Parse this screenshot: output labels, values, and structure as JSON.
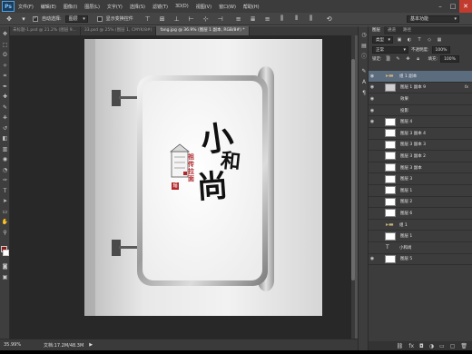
{
  "app": {
    "logo": "Ps"
  },
  "menu": [
    "文件(F)",
    "编辑(E)",
    "图像(I)",
    "图层(L)",
    "文字(Y)",
    "选择(S)",
    "滤镜(T)",
    "3D(D)",
    "视图(V)",
    "窗口(W)",
    "帮助(H)"
  ],
  "window_controls": {
    "minimize": "–",
    "maximize": "□",
    "close": "✕"
  },
  "options": {
    "auto_select_label": "自动选择:",
    "auto_select_checked": true,
    "auto_select_value": "图层",
    "transform_label": "显示变换控件",
    "workspace": "基本功能"
  },
  "tabs": [
    {
      "label": "未标题-1.psd @ 21.2% (图层 9...",
      "active": false
    },
    {
      "label": "33.psd @ 25% (图层 1, CMYK/8#)",
      "active": false
    },
    {
      "label": "fang.jpg @ 36.9% (图层 1 副本, RGB/8#) *",
      "active": true
    }
  ],
  "status": {
    "zoom": "35.99%",
    "doc_info": "文档:17.2M/48.3M",
    "arrow": "▶"
  },
  "layers_panel": {
    "tabs": [
      "图层",
      "通道",
      "路径"
    ],
    "filter_kind": "类型",
    "blend_mode": "正常",
    "opacity_label": "不透明度:",
    "opacity_value": "100%",
    "lock_label": "锁定:",
    "fill_label": "填充:",
    "fill_value": "100%",
    "layers": [
      {
        "name": "组 1 副本",
        "kind": "group",
        "visible": true,
        "selected": true,
        "fx": false
      },
      {
        "name": "图层 1 副本 9",
        "kind": "layer",
        "visible": true,
        "selected": false,
        "fx": true
      },
      {
        "name": "效果",
        "kind": "effect",
        "visible": true,
        "selected": false,
        "fx": false
      },
      {
        "name": "投影",
        "kind": "effect",
        "visible": true,
        "selected": false,
        "fx": false
      },
      {
        "name": "图层 4",
        "kind": "layer",
        "visible": true,
        "selected": false,
        "fx": false
      },
      {
        "name": "图层 3 副本 4",
        "kind": "layer",
        "visible": false,
        "selected": false,
        "fx": false
      },
      {
        "name": "图层 3 副本 3",
        "kind": "layer",
        "visible": false,
        "selected": false,
        "fx": false
      },
      {
        "name": "图层 3 副本 2",
        "kind": "layer",
        "visible": false,
        "selected": false,
        "fx": false
      },
      {
        "name": "图层 3 副本",
        "kind": "layer",
        "visible": false,
        "selected": false,
        "fx": false
      },
      {
        "name": "图层 3",
        "kind": "layer",
        "visible": false,
        "selected": false,
        "fx": false
      },
      {
        "name": "图层 1",
        "kind": "layer",
        "visible": false,
        "selected": false,
        "fx": false
      },
      {
        "name": "图层 2",
        "kind": "layer",
        "visible": false,
        "selected": false,
        "fx": false
      },
      {
        "name": "图层 6",
        "kind": "layer",
        "visible": false,
        "selected": false,
        "fx": false
      },
      {
        "name": "组 1",
        "kind": "group",
        "visible": false,
        "selected": false,
        "fx": false
      },
      {
        "name": "图层 1",
        "kind": "layer",
        "visible": false,
        "selected": false,
        "fx": false
      },
      {
        "name": "小和尚",
        "kind": "text",
        "visible": false,
        "selected": false,
        "fx": false
      },
      {
        "name": "图层 5",
        "kind": "layer",
        "visible": true,
        "selected": false,
        "fx": false
      }
    ]
  },
  "artwork": {
    "big_chars": [
      "小",
      "和",
      "尚"
    ],
    "red_chars": "祖传拉面",
    "stamp": "麵"
  }
}
